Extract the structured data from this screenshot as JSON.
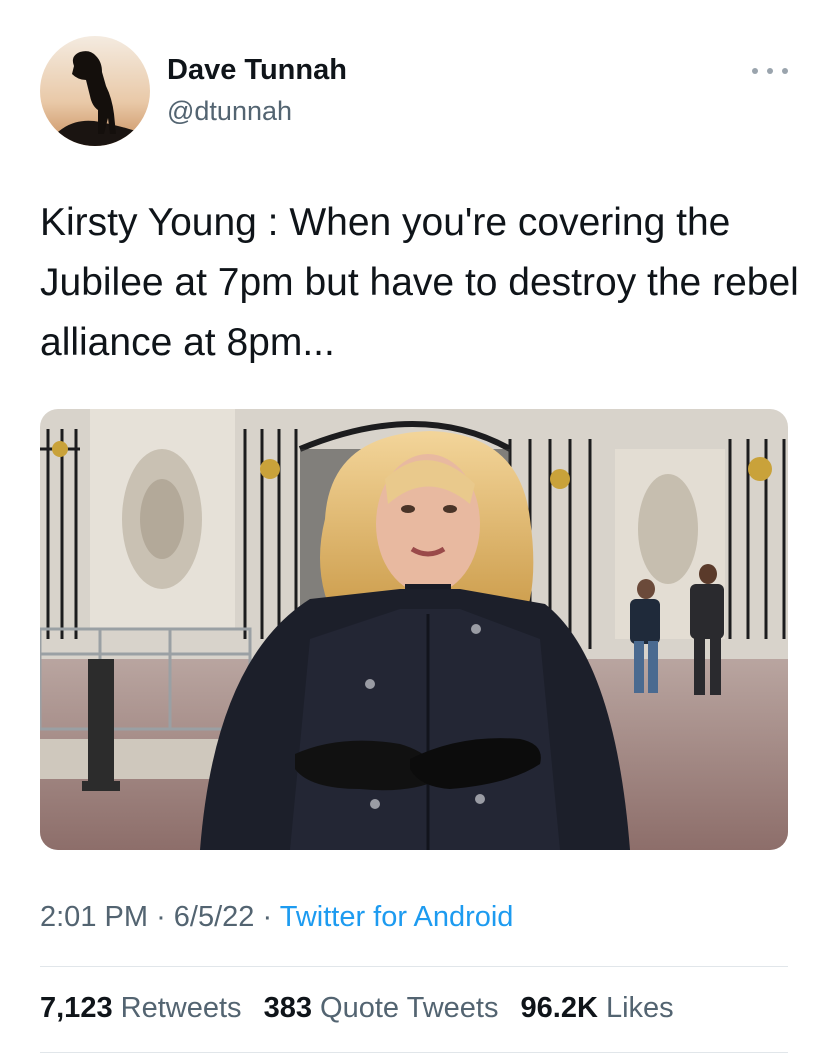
{
  "author": {
    "name": "Dave Tunnah",
    "handle": "@dtunnah"
  },
  "tweet": {
    "text": "Kirsty Young : When you're covering the Jubilee at 7pm but have to destroy the rebel alliance at 8pm...",
    "time": "2:01 PM",
    "date": "6/5/22",
    "separator": "·",
    "source": "Twitter for Android"
  },
  "stats": {
    "retweets_count": "7,123",
    "retweets_label": "Retweets",
    "quotes_count": "383",
    "quotes_label": "Quote Tweets",
    "likes_count": "96.2K",
    "likes_label": "Likes"
  },
  "colors": {
    "text": "#0f1419",
    "secondary": "#536471",
    "link": "#1d9bf0"
  }
}
